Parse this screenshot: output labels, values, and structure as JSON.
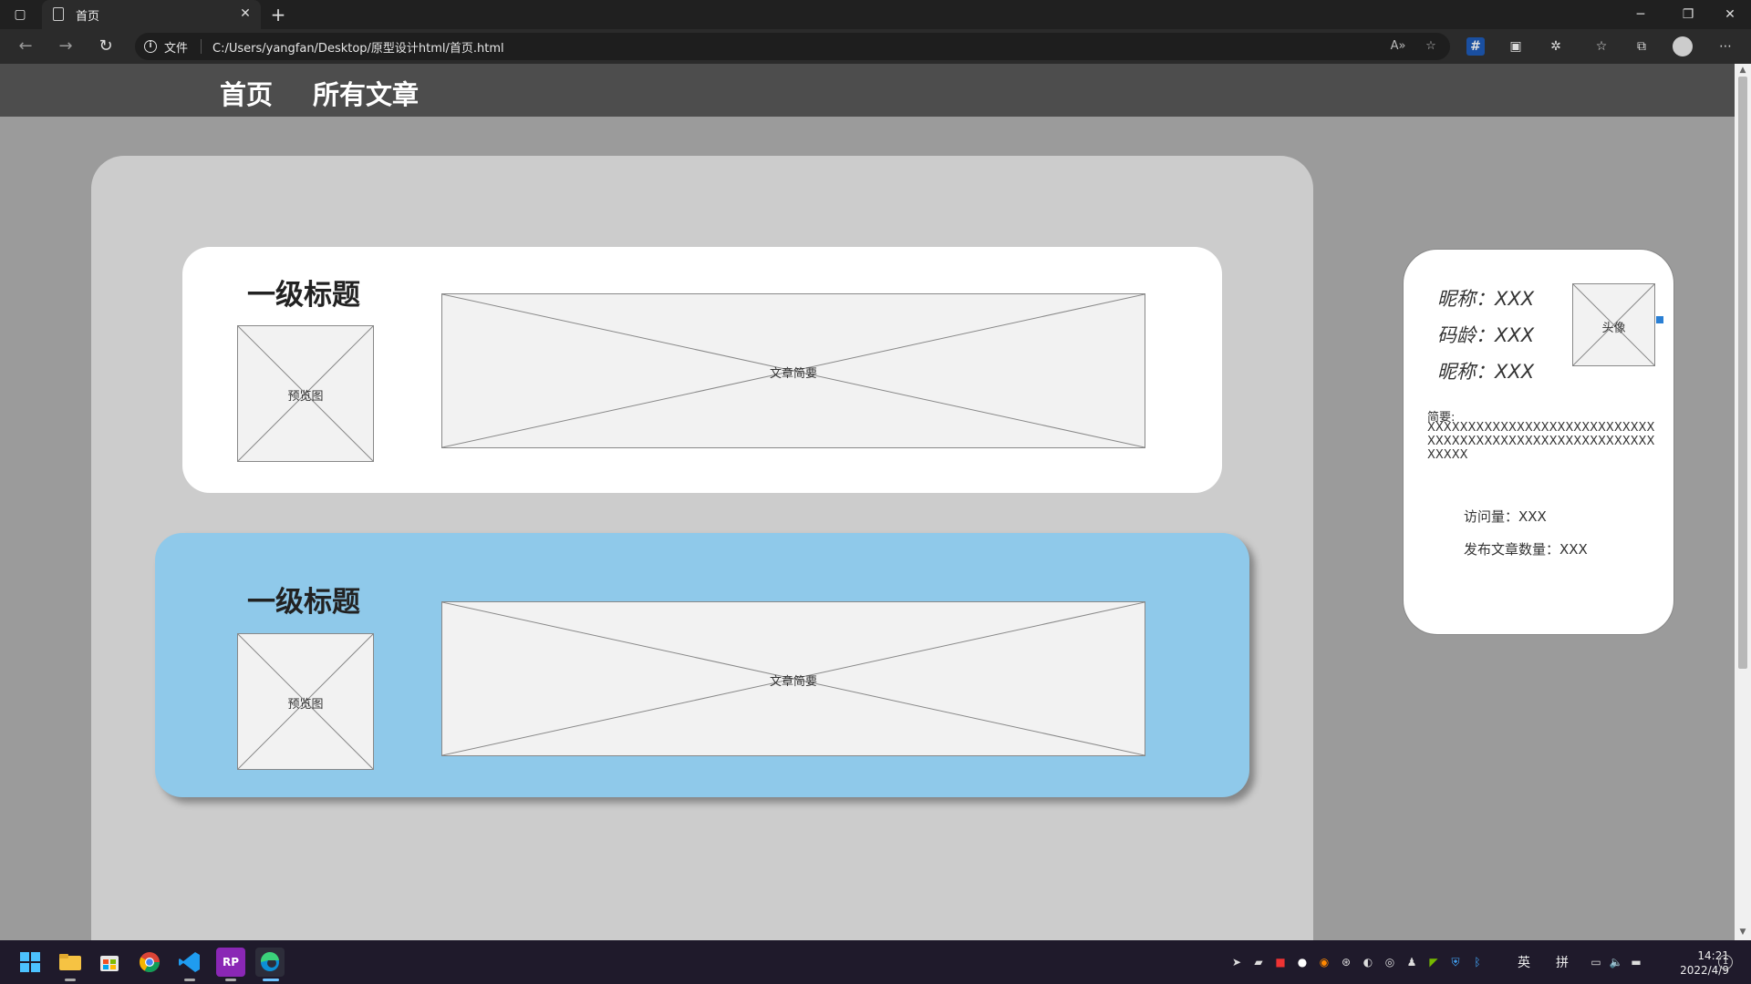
{
  "browser": {
    "tab_title": "首页",
    "tab_icon": "page-icon",
    "new_tab_glyph": "+",
    "close_glyph": "✕",
    "url_scheme_label": "文件",
    "url": "C:/Users/yangfan/Desktop/原型设计html/首页.html",
    "window_controls": {
      "minimize": "─",
      "restore": "❐",
      "close": "✕"
    },
    "nav": {
      "back": "←",
      "forward": "→",
      "refresh": "↻"
    },
    "toolbar_icons": [
      "read-aloud-icon",
      "add-favorite-icon",
      "extension-hash-icon",
      "extension-box-icon",
      "extensions-icon",
      "favorites-icon",
      "collections-icon",
      "profile-icon",
      "more-icon"
    ]
  },
  "site": {
    "nav_items": [
      "首页",
      "所有文章"
    ],
    "articles": [
      {
        "title": "一级标题",
        "preview_label": "预览图",
        "summary_label": "文章简要",
        "highlighted": false
      },
      {
        "title": "一级标题",
        "preview_label": "预览图",
        "summary_label": "文章简要",
        "highlighted": true
      }
    ],
    "profile": {
      "lines": [
        "昵称：XXX",
        "码龄：XXX",
        "昵称：XXX"
      ],
      "avatar_label": "头像",
      "summary_label": "简要:",
      "summary_text": "XXXXXXXXXXXXXXXXXXXXXXXXXXXXXXXXXXXXXXXXXXXXXXXXXXXXXXXXXXXXX",
      "visits": "访问量：XXX",
      "articles_count": "发布文章数量：XXX"
    },
    "colors": {
      "nav_bg": "#4d4d4d",
      "page_bg": "#9b9b9b",
      "panel_bg": "#cccccc",
      "card_bg": "#ffffff",
      "card_hover_bg": "#8fc9ea"
    }
  },
  "taskbar": {
    "apps": [
      "windows-start-icon",
      "file-explorer-icon",
      "store-icon",
      "chrome-icon",
      "vscode-icon",
      "axure-rp-icon",
      "edge-icon"
    ],
    "ime_lang": "英",
    "ime_mode": "拼",
    "time": "14:21",
    "date": "2022/4/9",
    "notifications": "1"
  }
}
